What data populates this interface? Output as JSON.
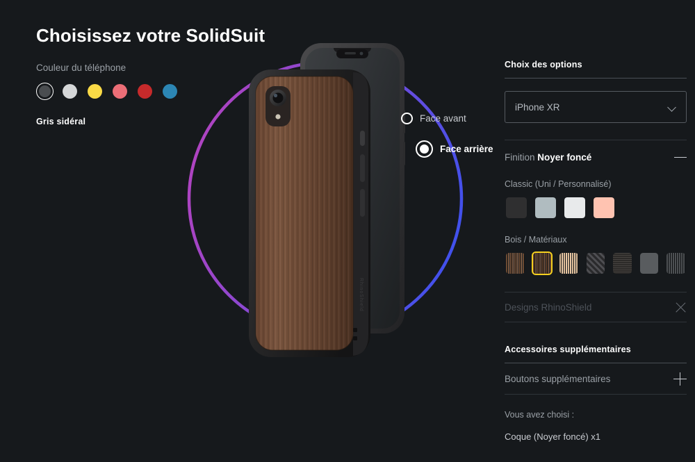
{
  "page": {
    "background": "#16191c"
  },
  "left": {
    "title": "Choisissez votre SolidSuit",
    "phone_color_label": "Couleur du téléphone",
    "selected_color_name": "Gris sidéral",
    "colors": [
      {
        "name": "gris-sideral",
        "hex": "#4a4d50",
        "selected": true
      },
      {
        "name": "blanc",
        "hex": "#d5d7d8",
        "selected": false
      },
      {
        "name": "jaune",
        "hex": "#fada46",
        "selected": false
      },
      {
        "name": "corail",
        "hex": "#ec6e77",
        "selected": false
      },
      {
        "name": "rouge",
        "hex": "#c62a2b",
        "selected": false
      },
      {
        "name": "bleu",
        "hex": "#2c86b4",
        "selected": false
      }
    ]
  },
  "stage": {
    "ring": {
      "from_color": "#b043c0",
      "to_color": "#3f51ec"
    },
    "faces": [
      {
        "key": "front",
        "label": "Face avant",
        "active": false
      },
      {
        "key": "back",
        "label": "Face arrière",
        "active": true
      }
    ]
  },
  "right": {
    "options_title": "Choix des options",
    "model_select": {
      "value": "iPhone XR",
      "placeholder": "iPhone XR",
      "icon": "chevron-down-icon"
    },
    "finition": {
      "prefix": "Finition",
      "value": "Noyer foncé",
      "toggle_icon": "minus-icon"
    },
    "classic": {
      "label": "Classic (Uni / Personnalisé)",
      "swatches": [
        {
          "name": "noir",
          "hex": "#2f2f30",
          "selected": false
        },
        {
          "name": "gris-bleu",
          "hex": "#b0bcc0",
          "selected": false
        },
        {
          "name": "blanc",
          "hex": "#e8eaeb",
          "selected": false
        },
        {
          "name": "rose-saumon",
          "hex": "#ffc3b1",
          "selected": false
        }
      ]
    },
    "materials": {
      "label": "Bois / Matériaux",
      "swatches": [
        {
          "name": "noyer-clair",
          "hex": "#6b4a33",
          "pattern": "wood",
          "selected": false
        },
        {
          "name": "noyer-fonce",
          "hex": "#5b3c29",
          "pattern": "wood",
          "selected": true
        },
        {
          "name": "bois-clair",
          "hex": "#dcbb97",
          "pattern": "wood",
          "selected": false
        },
        {
          "name": "carbone-diagonal",
          "hex": "#2a2a2c",
          "pattern": "diagonal",
          "selected": false
        },
        {
          "name": "cuir-graine",
          "hex": "#2c2a28",
          "pattern": "grain",
          "selected": false
        },
        {
          "name": "gris-uni",
          "hex": "#595c5f",
          "pattern": "solid",
          "selected": false
        },
        {
          "name": "gris-fibre",
          "hex": "#4d5053",
          "pattern": "fiber",
          "selected": false
        }
      ]
    },
    "designs": {
      "label": "Designs RhinoShield",
      "icon": "close-icon"
    },
    "accessories_title": "Accessoires supplémentaires",
    "accessory_row": {
      "label": "Boutons supplémentaires",
      "icon": "plus-icon"
    },
    "summary": {
      "label": "Vous avez choisi :",
      "items": [
        "Coque (Noyer foncé) x1"
      ]
    }
  }
}
